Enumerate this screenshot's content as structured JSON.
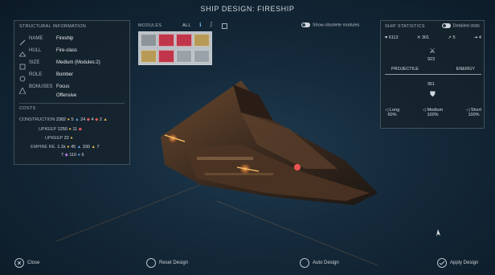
{
  "title": "SHIP DESIGN: FIRESHIP",
  "structural": {
    "header": "STRUCTURAL INFORMATION",
    "rows": [
      {
        "label": "NAME",
        "value": "Fireship"
      },
      {
        "label": "HULL",
        "value": "Fire-class"
      },
      {
        "label": "SIZE",
        "value": "Medium (Modules:2)"
      },
      {
        "label": "ROLE",
        "value": "Bomber"
      },
      {
        "label": "BONUSES",
        "value": "Focus",
        "value2": "Offensive"
      }
    ]
  },
  "costs": {
    "header": "COSTS",
    "construction": {
      "label": "CONSTRUCTION",
      "v1": "2382",
      "v2": "5",
      "v3": "24",
      "v4": "4",
      "v5": "2"
    },
    "upkeep": {
      "label": "UPKEEP",
      "v1": "1250",
      "v2": "11"
    },
    "upkeep2": {
      "label": "UPKEEP",
      "v1": "22"
    },
    "empire": {
      "label": "EMPIRE RE.",
      "v1": "1.1k",
      "v2": "45",
      "v3": "330",
      "v4": "7",
      "v5": "7",
      "v6": "110",
      "v7": "6"
    }
  },
  "modules": {
    "header": "MODULES",
    "filters": [
      "ALL"
    ],
    "show_obsolete": "Show obsolete modules"
  },
  "stats": {
    "header": "SHIP STATISTICS",
    "detailed": "Detailed stats",
    "hp": "6112",
    "attack": "301",
    "speed": "5",
    "range_val": "4",
    "top_value": "923",
    "projectile": "PROJECTILE",
    "energy": "ENERGY",
    "bottom_value": "951",
    "ranges": [
      {
        "label": "Long",
        "value": "60%"
      },
      {
        "label": "Medium",
        "value": "100%"
      },
      {
        "label": "Short",
        "value": "100%"
      }
    ]
  },
  "footer": {
    "close": "Close",
    "reset": "Reset Design",
    "auto": "Auto Design",
    "apply": "Apply Design"
  },
  "colors": {
    "accent": "#e0b14a",
    "module_red": "#c0354a",
    "module_gold": "#b79a56",
    "module_gray": "#9aa2a9"
  }
}
